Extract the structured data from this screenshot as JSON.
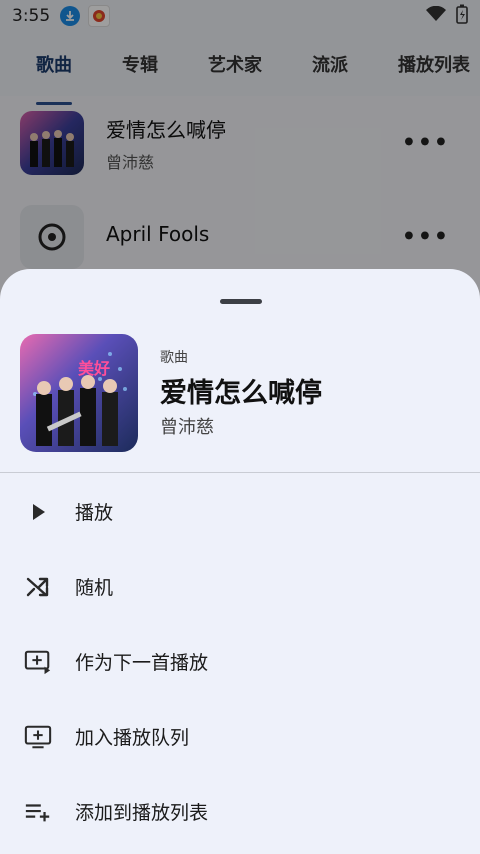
{
  "status": {
    "time": "3:55"
  },
  "tabs": [
    "歌曲",
    "专辑",
    "艺术家",
    "流派",
    "播放列表"
  ],
  "list": [
    {
      "title": "爱情怎么喊停",
      "artist": "曾沛慈"
    },
    {
      "title": "April Fools",
      "artist": ""
    }
  ],
  "sheet": {
    "kind": "歌曲",
    "title": "爱情怎么喊停",
    "artist": "曾沛慈",
    "cover_text": "美好"
  },
  "menu": [
    {
      "label": "播放",
      "icon": "play-icon"
    },
    {
      "label": "随机",
      "icon": "shuffle-icon"
    },
    {
      "label": "作为下一首播放",
      "icon": "play-next-icon"
    },
    {
      "label": "加入播放队列",
      "icon": "add-to-queue-icon"
    },
    {
      "label": "添加到播放列表",
      "icon": "add-to-playlist-icon"
    }
  ],
  "colors": {
    "accent": "#2a4f8e",
    "sheet_bg": "#eef1fa",
    "text": "#1b1b1b"
  }
}
